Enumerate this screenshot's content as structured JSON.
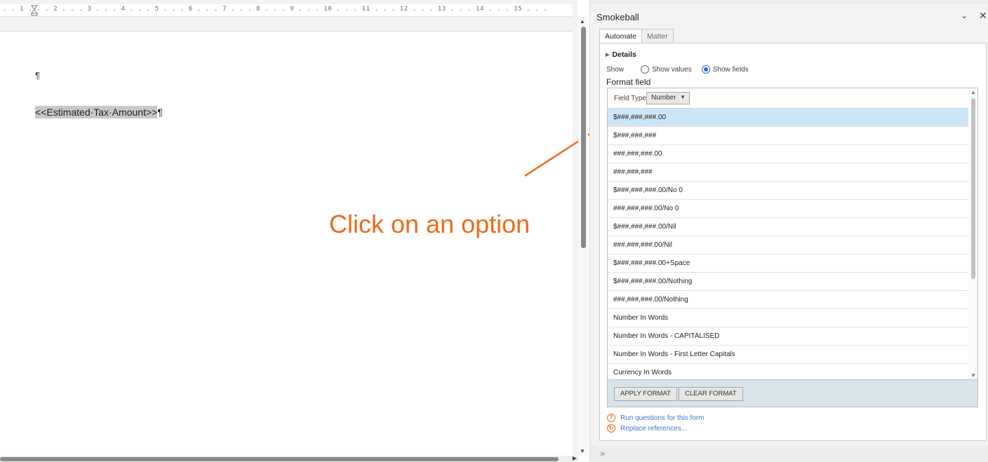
{
  "document": {
    "ruler_marks": ". . 1 . . . 2 . . . 3 . . . 4 . . . 5 . . . 6 . . . 7 . . . 8 . . . 9 . . . 10 . . . 11 . . . 12 . . . 13 . . . 14 . . . 15 . . .",
    "paragraph_mark": "¶",
    "merge_field": "<<Estimated·Tax·Amount>>",
    "merge_field_pilcrow": "¶"
  },
  "annotation": {
    "text": "Click on an option",
    "color": "#ec6a1c"
  },
  "panel": {
    "title": "Smokeball",
    "collapse_icon": "chevron-down-icon",
    "close_icon": "close-icon",
    "tabs": [
      {
        "label": "Automate",
        "active": true
      },
      {
        "label": "Matter",
        "active": false
      }
    ],
    "details_label": "Details",
    "show_label": "Show",
    "show_options": [
      {
        "label": "Show values",
        "checked": false
      },
      {
        "label": "Show fields",
        "checked": true
      }
    ],
    "format_field_label": "Format field",
    "field_type_label": "Field Type",
    "field_type_value": "Number",
    "format_options": [
      "$###,###,###.00",
      "$###,###,###",
      "###,###,###.00",
      "###,###,###",
      "$###,###,###.00/No 0",
      "###,###,###.00/No 0",
      "$###,###,###.00/Nil",
      "###,###,###.00/Nil",
      "$###,###,###.00+Space",
      "$###,###,###.00/Nothing",
      "###,###,###.00/Nothing",
      "Number In Words",
      "Number In Words - CAPITALISED",
      "Number In Words - First Letter Capitals",
      "Currency In Words"
    ],
    "selected_option_index": 0,
    "apply_format_label": "APPLY FORMAT",
    "clear_format_label": "CLEAR FORMAT",
    "run_questions_label": "Run questions for this form",
    "replace_references_label": "Replace references...",
    "selection_color": "#cde6f7",
    "link_color": "#3c77c9"
  }
}
